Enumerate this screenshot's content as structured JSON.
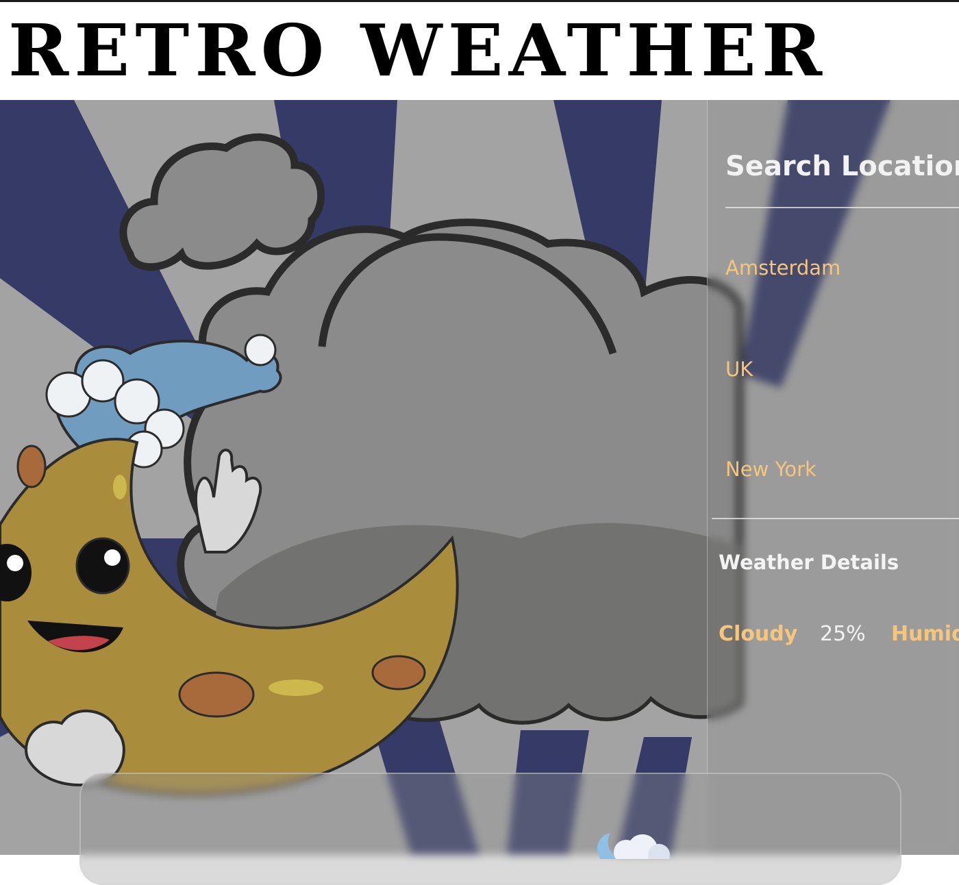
{
  "header": {
    "title": "RETRO WEATHER"
  },
  "search": {
    "title": "Search Location",
    "locations": [
      {
        "label": "Amsterdam"
      },
      {
        "label": "UK"
      },
      {
        "label": "New York"
      }
    ]
  },
  "weather_details": {
    "title": "Weather Details",
    "condition": "Cloudy",
    "percent": "25%",
    "next_label": "Humid"
  },
  "icons": {
    "card_icon": "moon-cloud-icon"
  },
  "colors": {
    "accent": "#f5c67c",
    "ray_dark": "#353a66",
    "ray_light": "#a3a3a3",
    "moon": "#a98c3c",
    "cloud": "#8b8b8b"
  }
}
